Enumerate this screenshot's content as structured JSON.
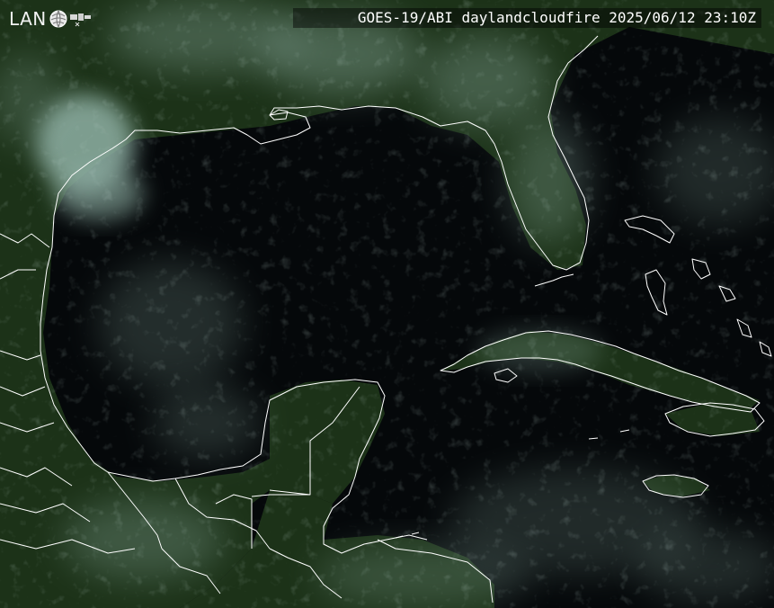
{
  "logo": {
    "text": "LAN",
    "icon": "globe-satellite-icon"
  },
  "caption": {
    "text": "GOES-19/ABI daylandcloudfire 2025/06/12 23:10Z"
  },
  "colors": {
    "ocean": "#05080a",
    "land": "#1c3218",
    "cloud": "#8fb0a4",
    "coastline": "#ffffff"
  }
}
